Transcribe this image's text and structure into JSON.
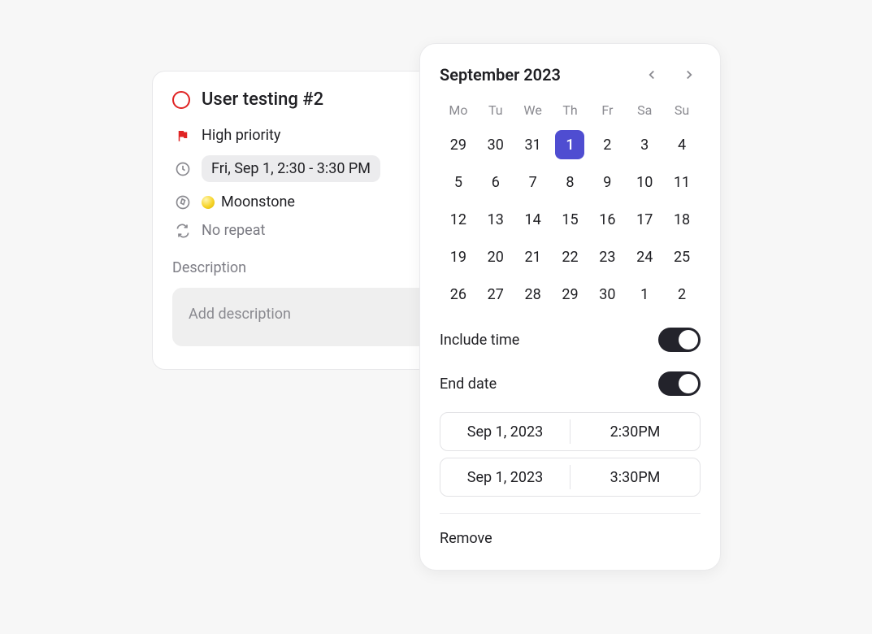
{
  "task": {
    "title": "User testing #2",
    "priority_label": "High priority",
    "date_label": "Fri, Sep 1, 2:30 - 3:30 PM",
    "project_label": "Moonstone",
    "repeat_label": "No repeat",
    "description_heading": "Description",
    "description_placeholder": "Add description"
  },
  "picker": {
    "month_label": "September 2023",
    "weekdays": [
      "Mo",
      "Tu",
      "We",
      "Th",
      "Fr",
      "Sa",
      "Su"
    ],
    "days": [
      {
        "n": "29",
        "o": true
      },
      {
        "n": "30",
        "o": true
      },
      {
        "n": "31",
        "o": true
      },
      {
        "n": "1",
        "sel": true
      },
      {
        "n": "2"
      },
      {
        "n": "3"
      },
      {
        "n": "4"
      },
      {
        "n": "5"
      },
      {
        "n": "6"
      },
      {
        "n": "7"
      },
      {
        "n": "8"
      },
      {
        "n": "9"
      },
      {
        "n": "10"
      },
      {
        "n": "11"
      },
      {
        "n": "12"
      },
      {
        "n": "13"
      },
      {
        "n": "14"
      },
      {
        "n": "15"
      },
      {
        "n": "16"
      },
      {
        "n": "17"
      },
      {
        "n": "18"
      },
      {
        "n": "19"
      },
      {
        "n": "20"
      },
      {
        "n": "21"
      },
      {
        "n": "22"
      },
      {
        "n": "23"
      },
      {
        "n": "24"
      },
      {
        "n": "25"
      },
      {
        "n": "26"
      },
      {
        "n": "27"
      },
      {
        "n": "28"
      },
      {
        "n": "29"
      },
      {
        "n": "30"
      },
      {
        "n": "1",
        "o": true
      },
      {
        "n": "2",
        "o": true
      }
    ],
    "include_time_label": "Include time",
    "include_time_on": true,
    "end_date_label": "End date",
    "end_date_on": true,
    "start": {
      "date": "Sep 1, 2023",
      "time": "2:30PM"
    },
    "end": {
      "date": "Sep 1, 2023",
      "time": "3:30PM"
    },
    "remove_label": "Remove"
  },
  "colors": {
    "accent": "#4f4dd1",
    "danger": "#e02424",
    "toggle": "#23232b"
  }
}
